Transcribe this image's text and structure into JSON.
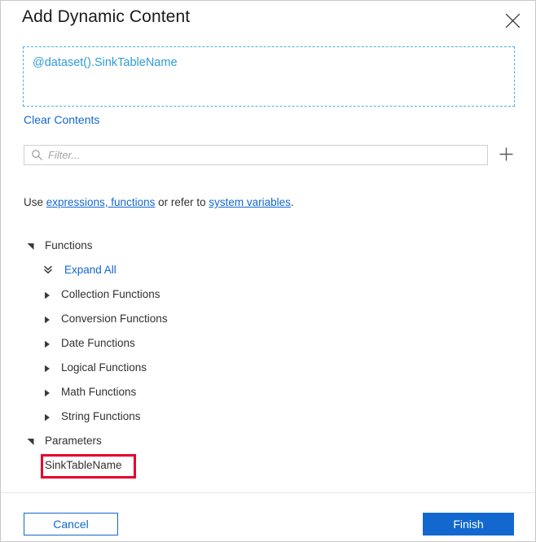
{
  "dialog": {
    "title": "Add Dynamic Content",
    "close_icon": "close-icon"
  },
  "expression": {
    "value": "@dataset().SinkTableName",
    "clear_label": "Clear Contents",
    "border_color": "#46b0e3",
    "text_color": "#2e9bd6"
  },
  "filter": {
    "placeholder": "Filter...",
    "value": "",
    "search_icon": "search-icon",
    "add_icon": "plus-icon"
  },
  "helper": {
    "prefix": "Use ",
    "link1": "expressions, functions",
    "middle": " or refer to ",
    "link2": "system variables",
    "suffix": "."
  },
  "tree": {
    "functions_group": "Functions",
    "expand_all": "Expand All",
    "function_categories": [
      "Collection Functions",
      "Conversion Functions",
      "Date Functions",
      "Logical Functions",
      "Math Functions",
      "String Functions"
    ],
    "parameters_group": "Parameters",
    "parameters": [
      "SinkTableName"
    ]
  },
  "footer": {
    "cancel_label": "Cancel",
    "finish_label": "Finish",
    "primary_color": "#1268cf"
  },
  "annotation": {
    "highlight_color": "#e5002d",
    "target": "SinkTableName"
  }
}
